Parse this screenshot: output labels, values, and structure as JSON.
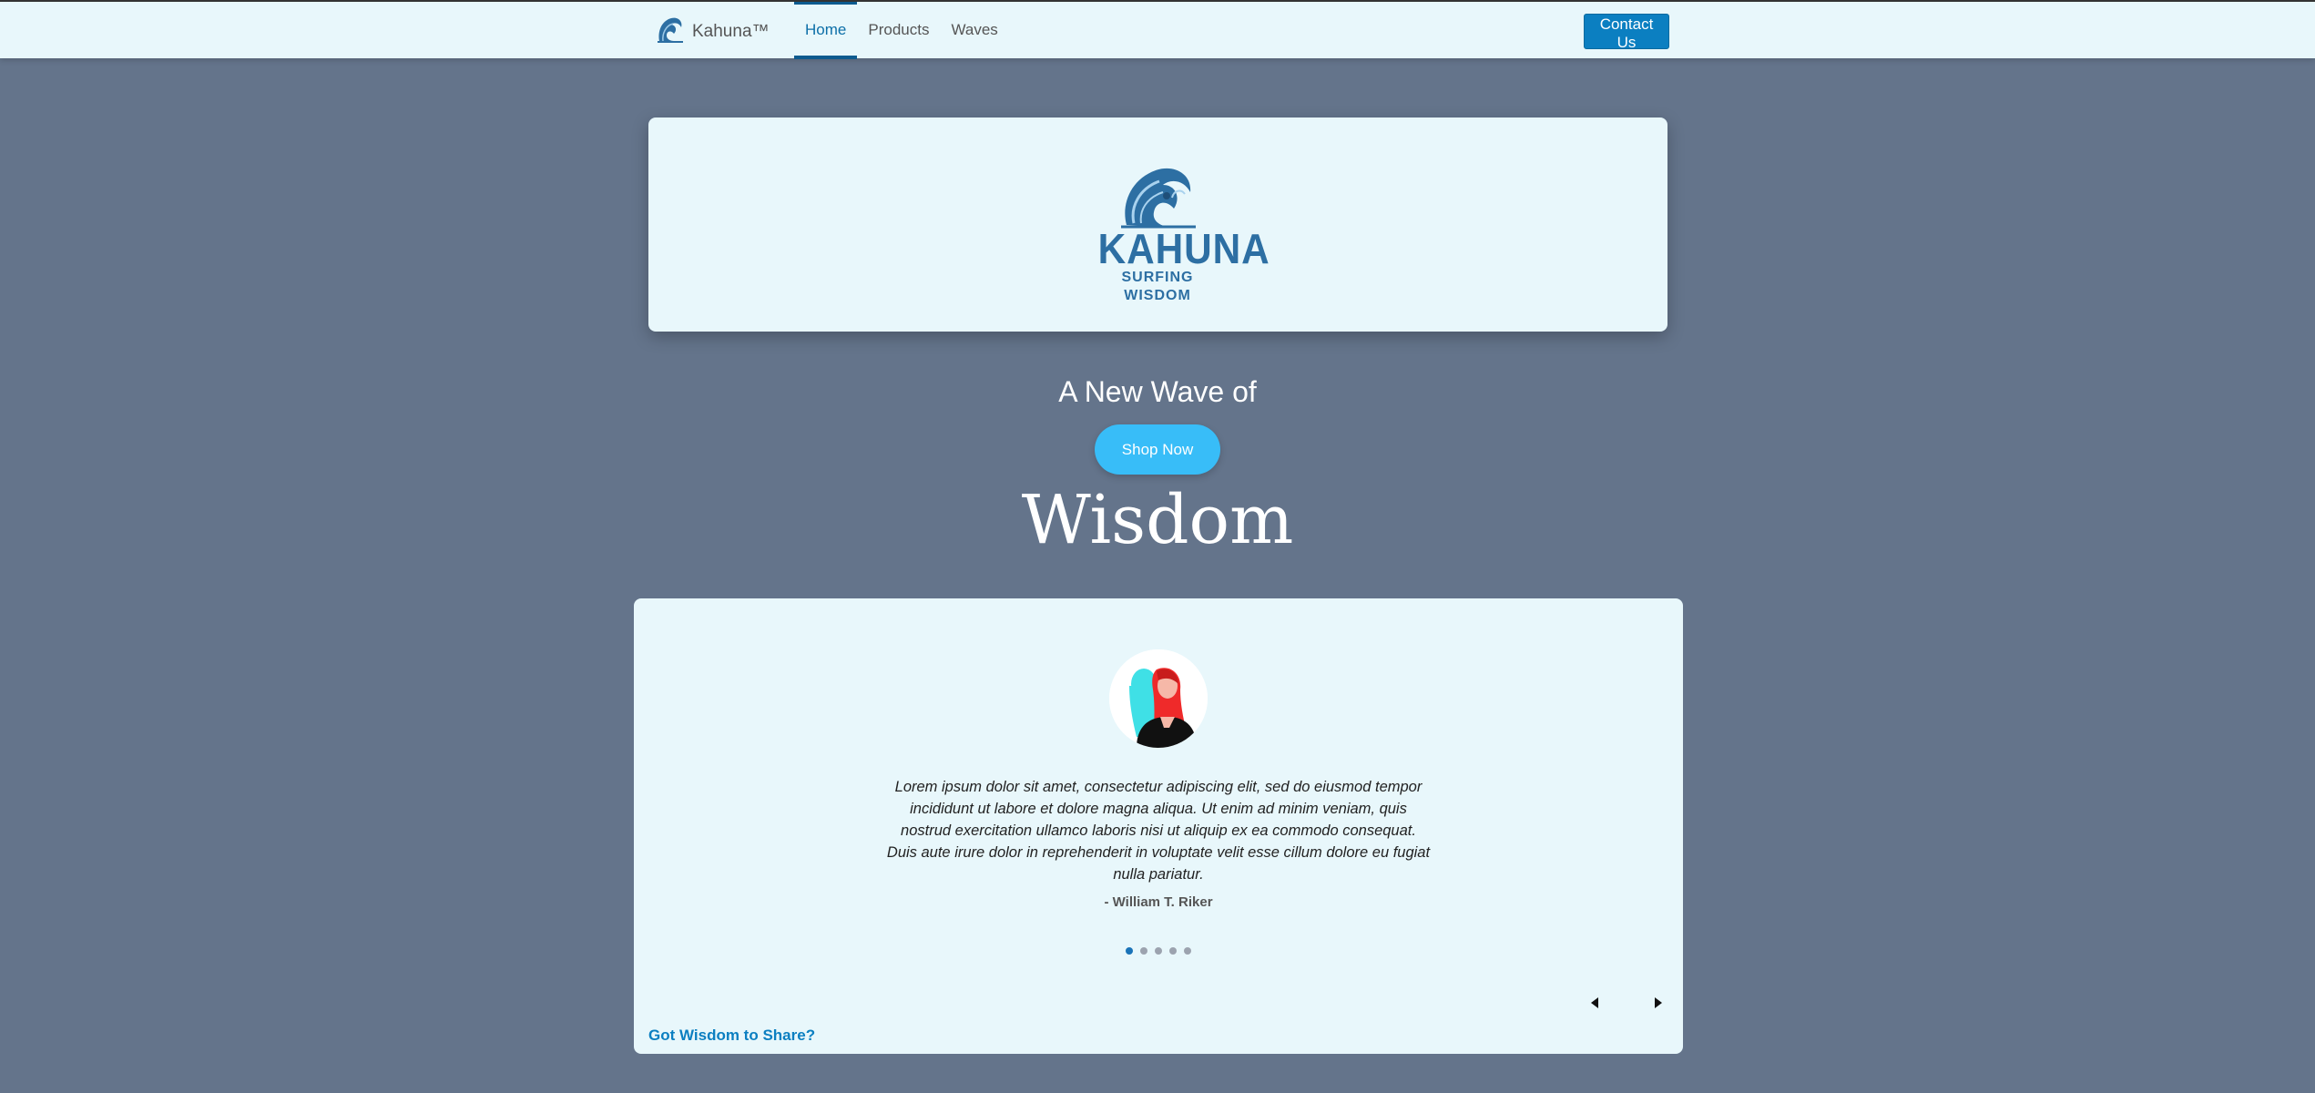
{
  "nav": {
    "brand": "Kahuna™",
    "items": [
      {
        "label": "Home",
        "active": true
      },
      {
        "label": "Products",
        "active": false
      },
      {
        "label": "Waves",
        "active": false
      }
    ],
    "contact_label": "Contact Us"
  },
  "hero": {
    "logo_main": "KAHUNA",
    "logo_sub": "SURFING WISDOM",
    "tagline": "A New Wave of",
    "shop_label": "Shop Now",
    "headline": "Wisdom"
  },
  "testimonial": {
    "quote": "Lorem ipsum dolor sit amet, consectetur adipiscing elit, sed do eiusmod tempor incididunt ut labore et dolore magna aliqua. Ut enim ad minim veniam, quis nostrud exercitation ullamco laboris nisi ut aliquip ex ea commodo consequat. Duis aute irure dolor in reprehenderit in voluptate velit esse cillum dolore eu fugiat nulla pariatur.",
    "author": "- William T. Riker",
    "slide_count": 5,
    "active_slide": 1,
    "share_label": "Got Wisdom to Share?"
  },
  "colors": {
    "background": "#64748b",
    "card": "#e8f7fb",
    "primary": "#0b7fc1",
    "accent": "#38bdf8"
  },
  "icons": [
    "wave-logo-icon",
    "avatar-photo",
    "prev-arrow-icon",
    "next-arrow-icon"
  ]
}
